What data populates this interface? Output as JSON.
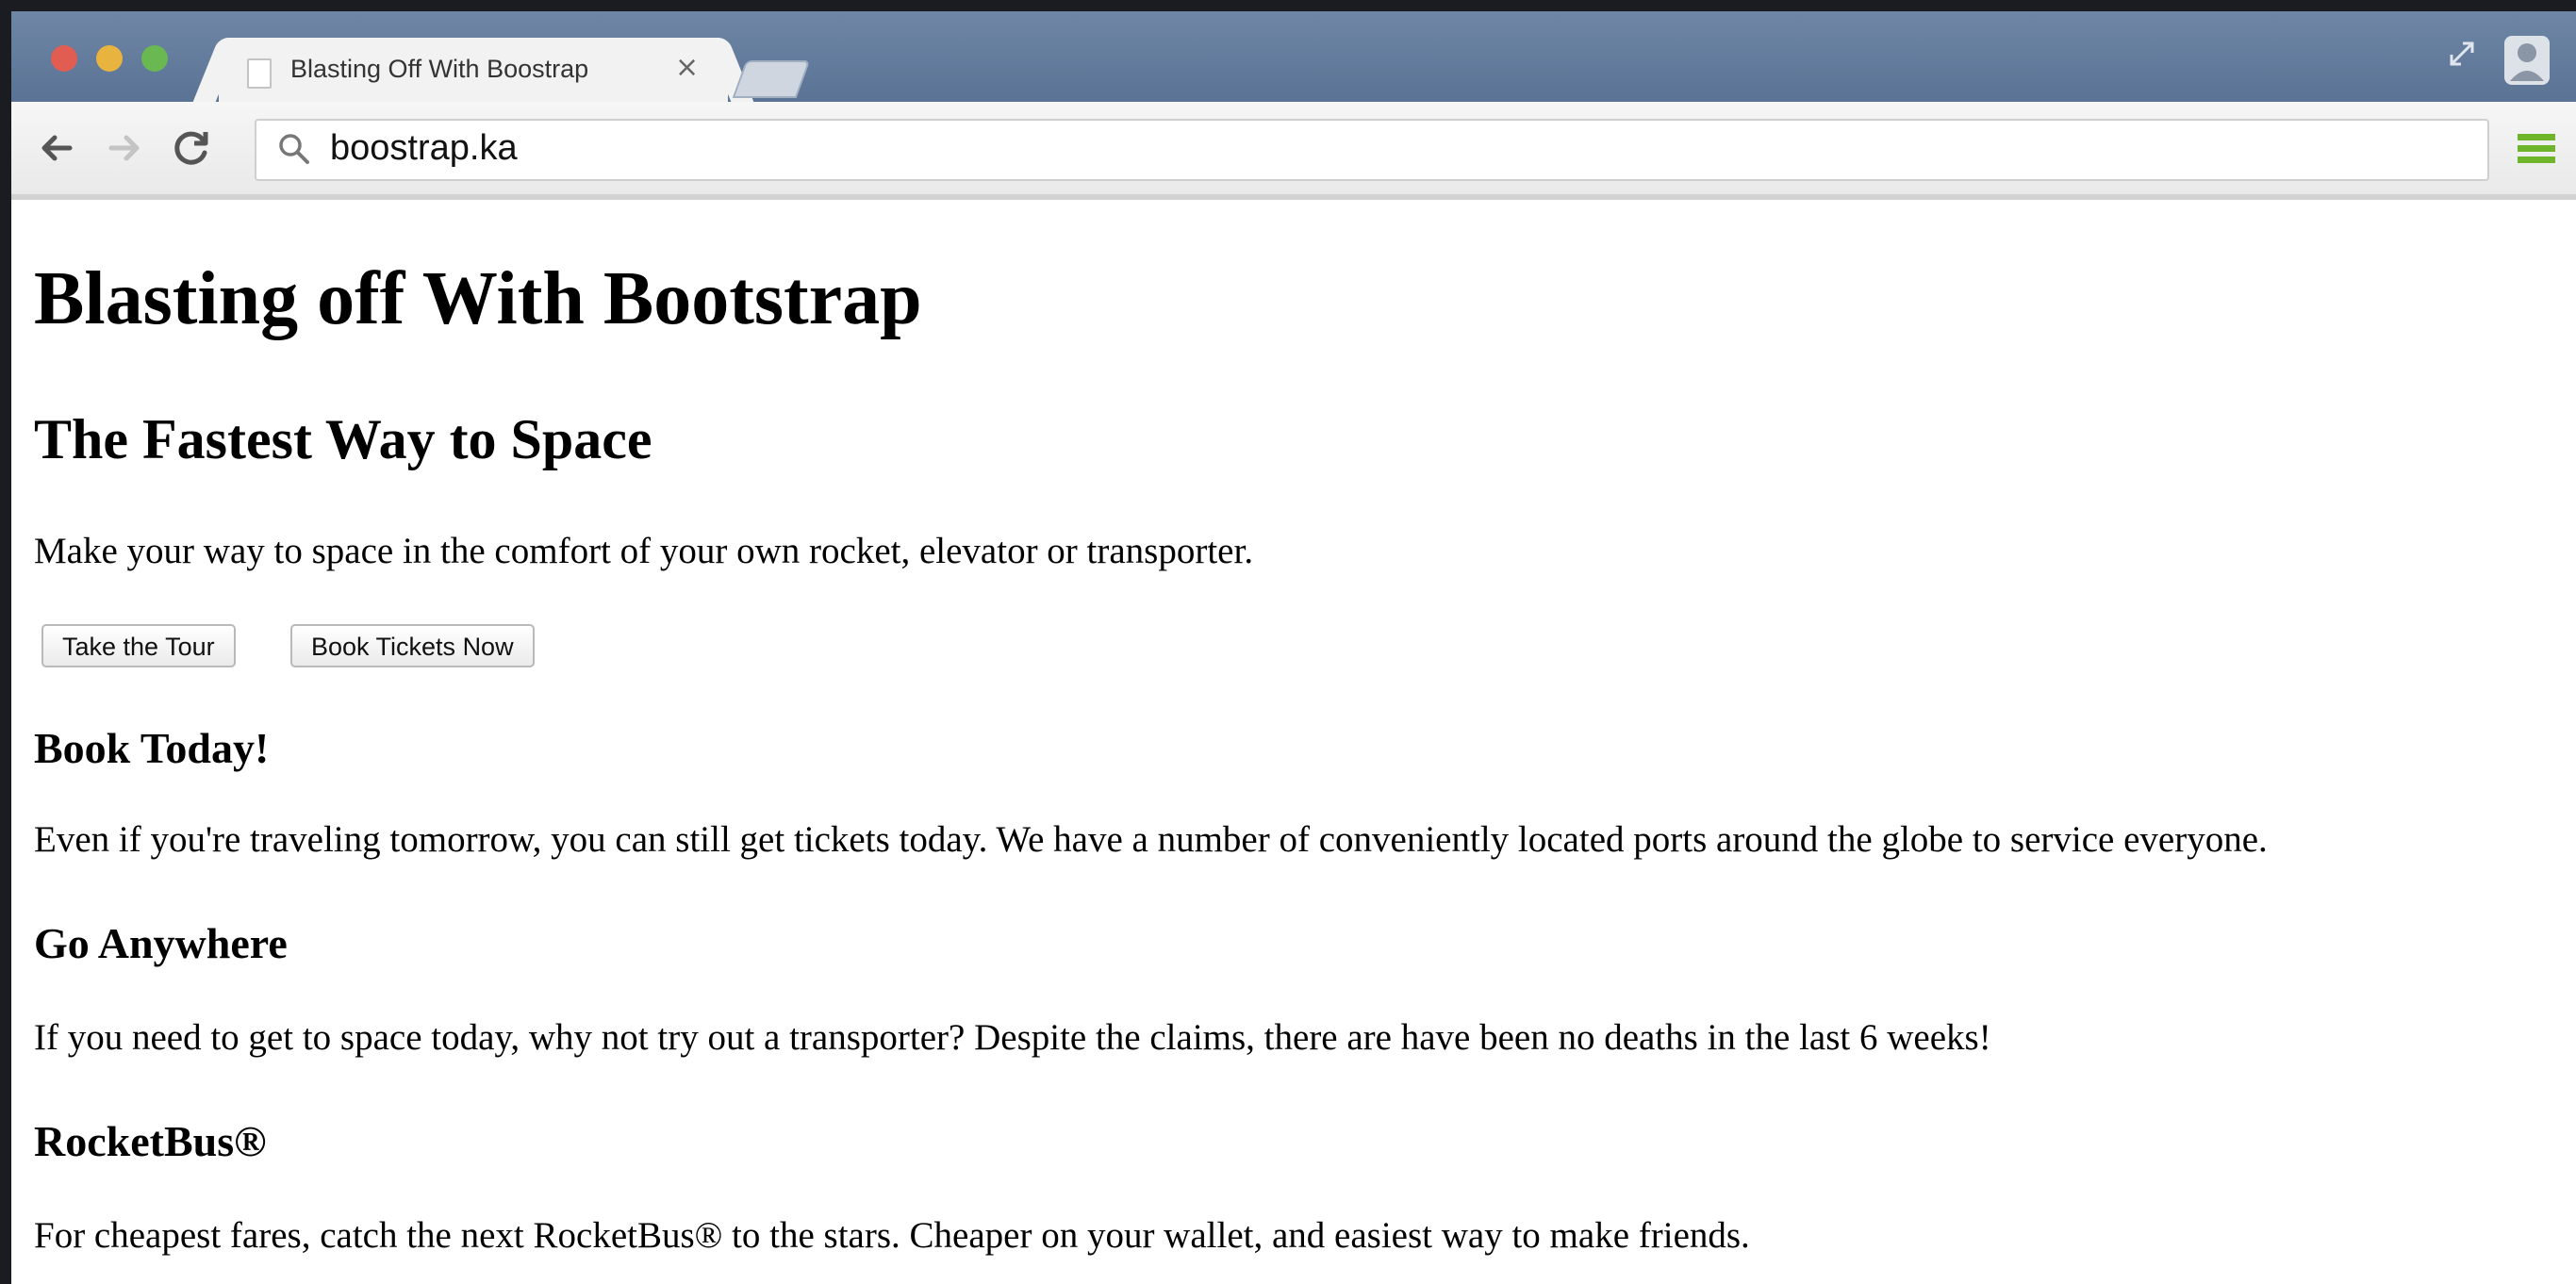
{
  "browser": {
    "tab_title": "Blasting Off With Boostrap",
    "tab_close": "×",
    "url": "boostrap.ka",
    "icons": [
      "back-icon",
      "forward-icon",
      "reload-icon",
      "search-icon",
      "menu-icon",
      "profile-icon",
      "fullscreen-icon"
    ]
  },
  "page": {
    "title": "Blasting off With Bootstrap",
    "subtitle": "The Fastest Way to Space",
    "intro": "Make your way to space in the comfort of your own rocket, elevator or transporter.",
    "buttons": {
      "tour": "Take the Tour",
      "book": "Book Tickets Now"
    },
    "sections": [
      {
        "heading": "Book Today!",
        "body": "Even if you're traveling tomorrow, you can still get tickets today. We have a number of conveniently located ports around the globe to service everyone."
      },
      {
        "heading": "Go Anywhere",
        "body": "If you need to get to space today, why not try out a transporter? Despite the claims, there are have been no deaths in the last 6 weeks!"
      },
      {
        "heading": "RocketBus®",
        "body": "For cheapest fares, catch the next RocketBus® to the stars. Cheaper on your wallet, and easiest way to make friends."
      }
    ]
  }
}
